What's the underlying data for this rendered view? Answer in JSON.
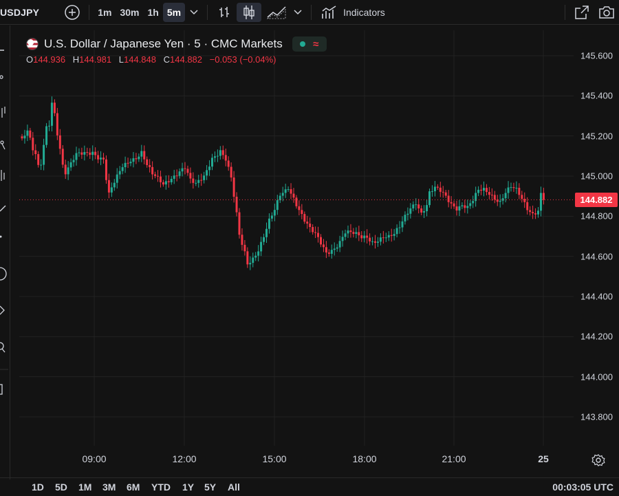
{
  "toolbar": {
    "symbol": "USDJPY",
    "intervals": [
      "1m",
      "30m",
      "1h",
      "5m"
    ],
    "active_interval": "5m",
    "indicators_label": "Indicators"
  },
  "legend": {
    "title": "U.S. Dollar / Japanese Yen · 5 · CMC Markets",
    "market_status_symbol": "≈",
    "ohlc": {
      "o_label": "O",
      "o": "144.936",
      "h_label": "H",
      "h": "144.981",
      "l_label": "L",
      "l": "144.848",
      "c_label": "C",
      "c": "144.882",
      "change": "−0.053 (−0.04%)"
    }
  },
  "price_axis": {
    "labels": [
      "145.600",
      "145.400",
      "145.200",
      "145.000",
      "144.800",
      "144.600",
      "144.400",
      "144.200",
      "144.000",
      "143.800"
    ],
    "current_price": "144.882"
  },
  "time_axis": {
    "labels": [
      "09:00",
      "12:00",
      "15:00",
      "18:00",
      "21:00",
      "25"
    ]
  },
  "bottom_bar": {
    "ranges": [
      "1D",
      "5D",
      "1M",
      "3M",
      "6M",
      "YTD",
      "1Y",
      "5Y",
      "All"
    ],
    "clock": "00:03:05 UTC"
  },
  "colors": {
    "up": "#22ab94",
    "down": "#f23645",
    "background": "#131313",
    "grid": "#222222"
  },
  "chart_data": {
    "type": "candlestick",
    "title": "U.S. Dollar / Japanese Yen · 5 · CMC Markets",
    "ylim": [
      143.7,
      145.7
    ],
    "y_ticks": [
      145.6,
      145.4,
      145.2,
      145.0,
      144.8,
      144.6,
      144.4,
      144.2,
      144.0,
      143.8
    ],
    "x_ticks": [
      "09:00",
      "12:00",
      "15:00",
      "18:00",
      "21:00",
      "25"
    ],
    "last_price": 144.882,
    "close_path": [
      [
        0,
        145.18
      ],
      [
        2,
        145.22
      ],
      [
        4,
        145.12
      ],
      [
        5,
        145.1
      ],
      [
        6,
        145.04
      ],
      [
        7,
        145.06
      ],
      [
        8,
        145.16
      ],
      [
        9,
        145.25
      ],
      [
        10,
        145.27
      ],
      [
        11,
        145.38
      ],
      [
        12,
        145.32
      ],
      [
        13,
        145.22
      ],
      [
        14,
        145.14
      ],
      [
        15,
        145.05
      ],
      [
        16,
        145.01
      ],
      [
        18,
        145.05
      ],
      [
        20,
        145.1
      ],
      [
        23,
        145.12
      ],
      [
        26,
        145.13
      ],
      [
        28,
        145.1
      ],
      [
        30,
        145.08
      ],
      [
        31,
        144.98
      ],
      [
        32,
        144.9
      ],
      [
        33,
        144.93
      ],
      [
        35,
        144.99
      ],
      [
        37,
        145.05
      ],
      [
        40,
        145.09
      ],
      [
        42,
        145.1
      ],
      [
        44,
        145.12
      ],
      [
        46,
        145.05
      ],
      [
        48,
        145.0
      ],
      [
        50,
        144.98
      ],
      [
        52,
        144.96
      ],
      [
        55,
        145.0
      ],
      [
        58,
        145.03
      ],
      [
        60,
        145.04
      ],
      [
        62,
        144.97
      ],
      [
        64,
        144.95
      ],
      [
        67,
        145.0
      ],
      [
        70,
        145.1
      ],
      [
        73,
        145.13
      ],
      [
        75,
        145.08
      ],
      [
        77,
        144.98
      ],
      [
        79,
        144.8
      ],
      [
        80,
        144.7
      ],
      [
        82,
        144.62
      ],
      [
        83,
        144.57
      ],
      [
        85,
        144.6
      ],
      [
        87,
        144.64
      ],
      [
        89,
        144.7
      ],
      [
        91,
        144.77
      ],
      [
        93,
        144.82
      ],
      [
        95,
        144.9
      ],
      [
        97,
        144.93
      ],
      [
        98,
        144.95
      ],
      [
        100,
        144.9
      ],
      [
        102,
        144.84
      ],
      [
        104,
        144.78
      ],
      [
        106,
        144.73
      ],
      [
        108,
        144.7
      ],
      [
        110,
        144.66
      ],
      [
        112,
        144.62
      ],
      [
        113,
        144.63
      ],
      [
        115,
        144.65
      ],
      [
        117,
        144.68
      ],
      [
        119,
        144.72
      ],
      [
        121,
        144.71
      ],
      [
        123,
        144.7
      ],
      [
        125,
        144.69
      ],
      [
        127,
        144.7
      ],
      [
        129,
        144.68
      ],
      [
        131,
        144.69
      ],
      [
        133,
        144.7
      ],
      [
        135,
        144.69
      ],
      [
        137,
        144.7
      ],
      [
        139,
        144.74
      ],
      [
        141,
        144.8
      ],
      [
        143,
        144.85
      ],
      [
        145,
        144.88
      ],
      [
        147,
        144.82
      ],
      [
        149,
        144.85
      ],
      [
        150,
        144.91
      ],
      [
        152,
        144.93
      ],
      [
        154,
        144.92
      ],
      [
        156,
        144.9
      ],
      [
        158,
        144.87
      ],
      [
        160,
        144.85
      ],
      [
        162,
        144.86
      ],
      [
        164,
        144.84
      ],
      [
        166,
        144.87
      ],
      [
        168,
        144.92
      ],
      [
        170,
        144.93
      ],
      [
        172,
        144.92
      ],
      [
        174,
        144.9
      ],
      [
        176,
        144.88
      ],
      [
        178,
        144.92
      ],
      [
        180,
        144.94
      ],
      [
        182,
        144.92
      ],
      [
        184,
        144.88
      ],
      [
        186,
        144.84
      ],
      [
        188,
        144.82
      ],
      [
        190,
        144.84
      ],
      [
        191,
        144.92
      ],
      [
        192,
        144.88
      ]
    ]
  }
}
